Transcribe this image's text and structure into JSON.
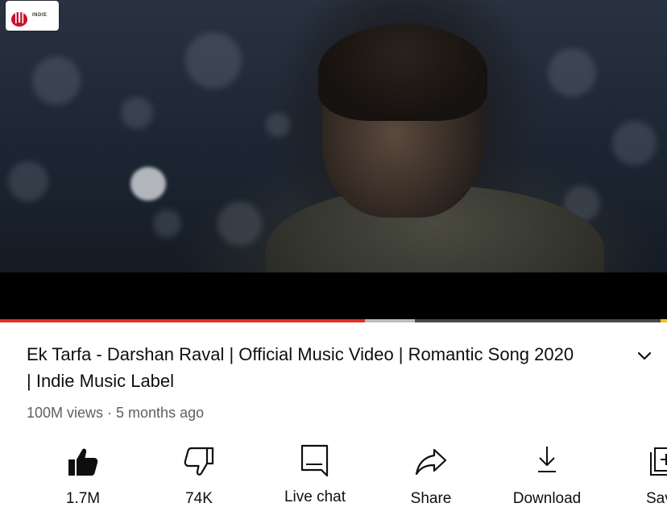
{
  "video": {
    "channel_logo_text": "INDIE",
    "progress_played_percent": 54.7,
    "progress_buffered_percent": 62.2
  },
  "details": {
    "title": "Ek Tarfa - Darshan Raval | Official Music Video | Romantic Song 2020 | Indie Music Label",
    "meta": "100M views · 5 months ago"
  },
  "actions": {
    "like": {
      "label": "1.7M",
      "icon": "thumbs-up-filled-icon"
    },
    "dislike": {
      "label": "74K",
      "icon": "thumbs-down-icon"
    },
    "live_chat": {
      "label": "Live chat",
      "icon": "chat-icon"
    },
    "share": {
      "label": "Share",
      "icon": "share-arrow-icon"
    },
    "download": {
      "label": "Download",
      "icon": "download-icon"
    },
    "save": {
      "label": "Save",
      "icon": "playlist-add-icon"
    }
  },
  "colors": {
    "progress_played": "#e52d27",
    "progress_buffered": "#bdbdbd",
    "ad_marker": "#f3c11a",
    "text_primary": "#0f0f0f",
    "text_secondary": "#606060"
  }
}
